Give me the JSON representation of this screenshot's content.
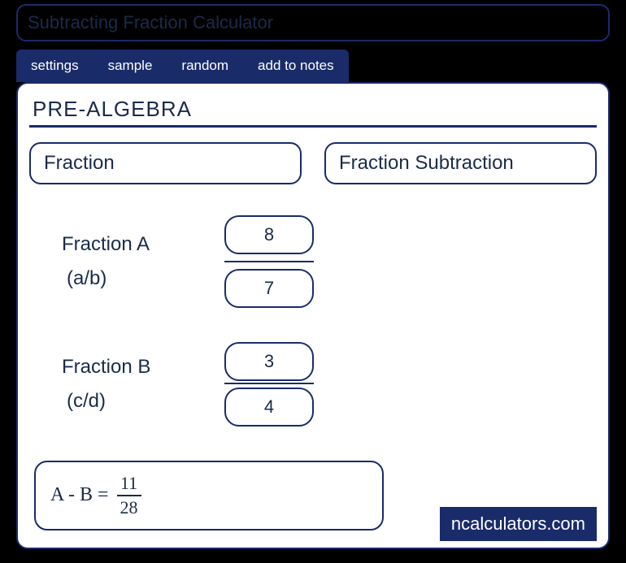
{
  "title": "Subtracting Fraction Calculator",
  "tabs": {
    "settings": "settings",
    "sample": "sample",
    "random": "random",
    "add_to_notes": "add to notes"
  },
  "section_heading": "PRE-ALGEBRA",
  "chips": {
    "left": "Fraction",
    "right": "Fraction Subtraction"
  },
  "fraction_a": {
    "label": "Fraction A",
    "sub": "(a/b)",
    "numerator": "8",
    "denominator": "7"
  },
  "fraction_b": {
    "label": "Fraction B",
    "sub": "(c/d)",
    "numerator": "3",
    "denominator": "4"
  },
  "result": {
    "prefix": "A - B  =",
    "numerator": "11",
    "denominator": "28"
  },
  "brand": "ncalculators.com"
}
